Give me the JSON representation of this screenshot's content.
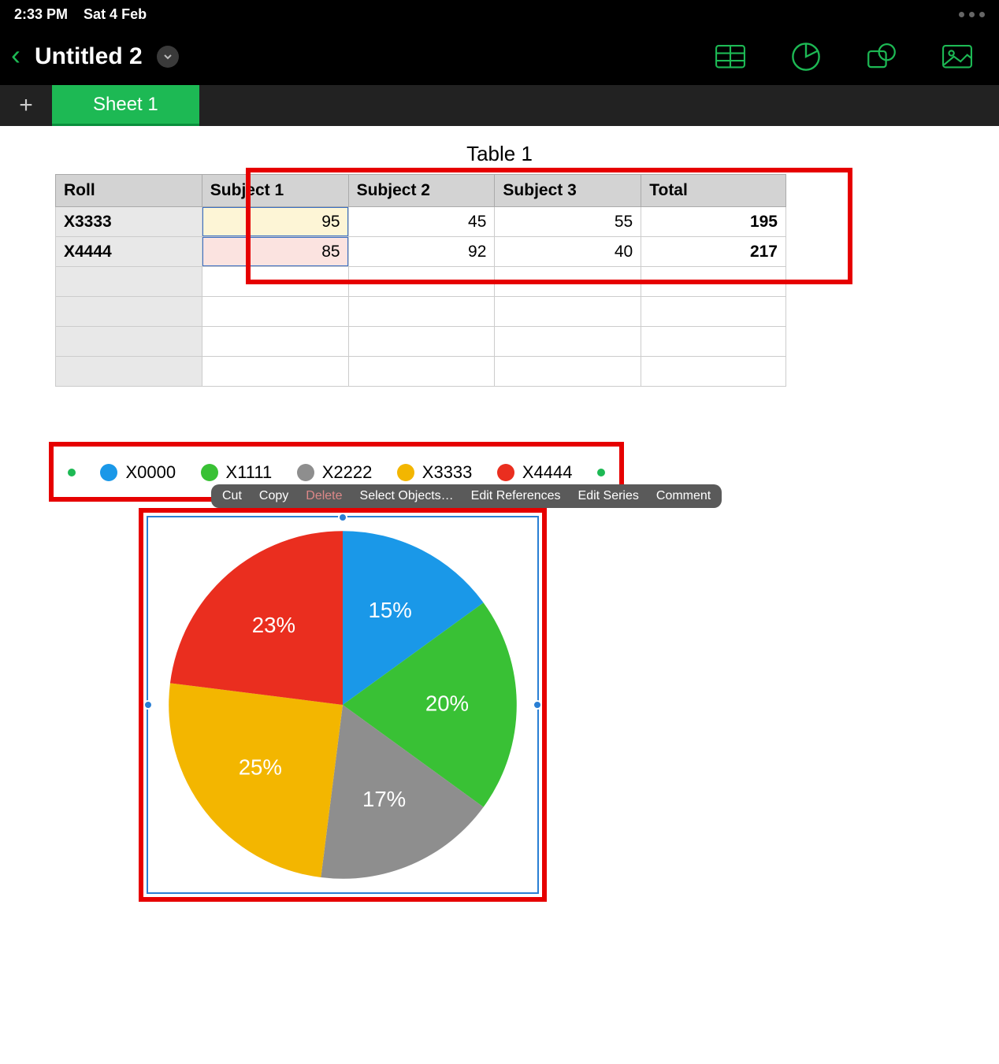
{
  "status": {
    "time": "2:33 PM",
    "date": "Sat 4 Feb"
  },
  "header": {
    "title": "Untitled 2"
  },
  "tabs": {
    "active": "Sheet 1"
  },
  "table": {
    "title": "Table 1",
    "headers": [
      "Roll",
      "Subject 1",
      "Subject 2",
      "Subject 3",
      "Total"
    ],
    "rows": [
      {
        "roll": "X3333",
        "s1": "95",
        "s2": "45",
        "s3": "55",
        "total": "195"
      },
      {
        "roll": "X4444",
        "s1": "85",
        "s2": "92",
        "s3": "40",
        "total": "217"
      }
    ]
  },
  "legend": {
    "items": [
      {
        "label": "X0000",
        "color": "#1a98e8"
      },
      {
        "label": "X1111",
        "color": "#39c135"
      },
      {
        "label": "X2222",
        "color": "#8e8e8e"
      },
      {
        "label": "X3333",
        "color": "#f3b600"
      },
      {
        "label": "X4444",
        "color": "#ea2e1f"
      }
    ]
  },
  "context_menu": {
    "items": [
      "Cut",
      "Copy",
      "Delete",
      "Select Objects…",
      "Edit References",
      "Edit Series",
      "Comment"
    ]
  },
  "chart_data": {
    "type": "pie",
    "series": [
      {
        "name": "X0000",
        "value": 15,
        "color": "#1a98e8",
        "label": "15%"
      },
      {
        "name": "X1111",
        "value": 20,
        "color": "#39c135",
        "label": "20%"
      },
      {
        "name": "X2222",
        "value": 17,
        "color": "#8e8e8e",
        "label": "17%"
      },
      {
        "name": "X3333",
        "value": 25,
        "color": "#f3b600",
        "label": "25%"
      },
      {
        "name": "X4444",
        "value": 23,
        "color": "#ea2e1f",
        "label": "23%"
      }
    ]
  }
}
